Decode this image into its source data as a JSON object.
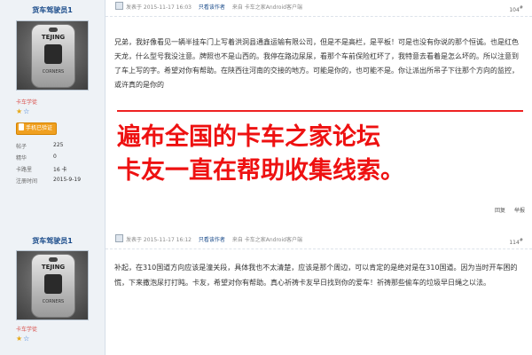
{
  "posts": [
    {
      "username": "货车驾驶员1",
      "avatar_tag_text": "TEJING",
      "avatar_tag_sub": "CORNERS",
      "rank_label": "卡车学徒",
      "stars": "★☆",
      "badge_label": "手机已验证",
      "stats": [
        {
          "label": "帖子",
          "value": "225"
        },
        {
          "label": "精华",
          "value": "0"
        },
        {
          "label": "卡路里",
          "value": "16 卡"
        },
        {
          "label": "注册时间",
          "value": "2015-9-19"
        }
      ],
      "posted_at": "发表于 2015-11-17 16:03",
      "author_only": "只看该作者",
      "from": "来自 卡车之家Android客户端",
      "floor": "104",
      "floor_suffix": "#",
      "body": "兄弟，我好像看见一辆半挂车门上写着洪洞县通鑫运输有限公司，但是不是高栏，是平板！可是也没有你说的那个恒诚。也是红色天龙，什么型号我没注意。牌照也不是山西的。我停在路边尿尿，看那个车前保险杠坏了，我特意去看着是怎么坏的。所以注意到了车上写的字。希望对你有帮助。在陕西往河南的交接的地方。可能是你的，也可能不是。你让派出所吊子下往那个方向的监控，或许真的是你的",
      "overlay_line1": "遍布全国的卡车之家论坛",
      "overlay_line2": "卡友一直在帮助收集线索。",
      "actions": [
        "回复",
        "举报"
      ]
    },
    {
      "username": "货车驾驶员1",
      "avatar_tag_text": "TEJING",
      "avatar_tag_sub": "CORNERS",
      "rank_label": "卡车学徒",
      "stars": "★☆",
      "posted_at": "发表于 2015-11-17 16:12",
      "author_only": "只看该作者",
      "from": "来自 卡车之家Android客户端",
      "floor": "114",
      "floor_suffix": "#",
      "body": "补起，在310国道方向应该是潼关段，具体我也不太清楚，应该是那个周边，可以肯定的是绝对是在310国道。因为当时开车困的慌，下来撒泡尿打打盹。卡友，希望对你有帮助。真心祈祷卡友早日找到你的爱车！祈祷那些偷车的垃圾早日绳之以法。"
    }
  ]
}
